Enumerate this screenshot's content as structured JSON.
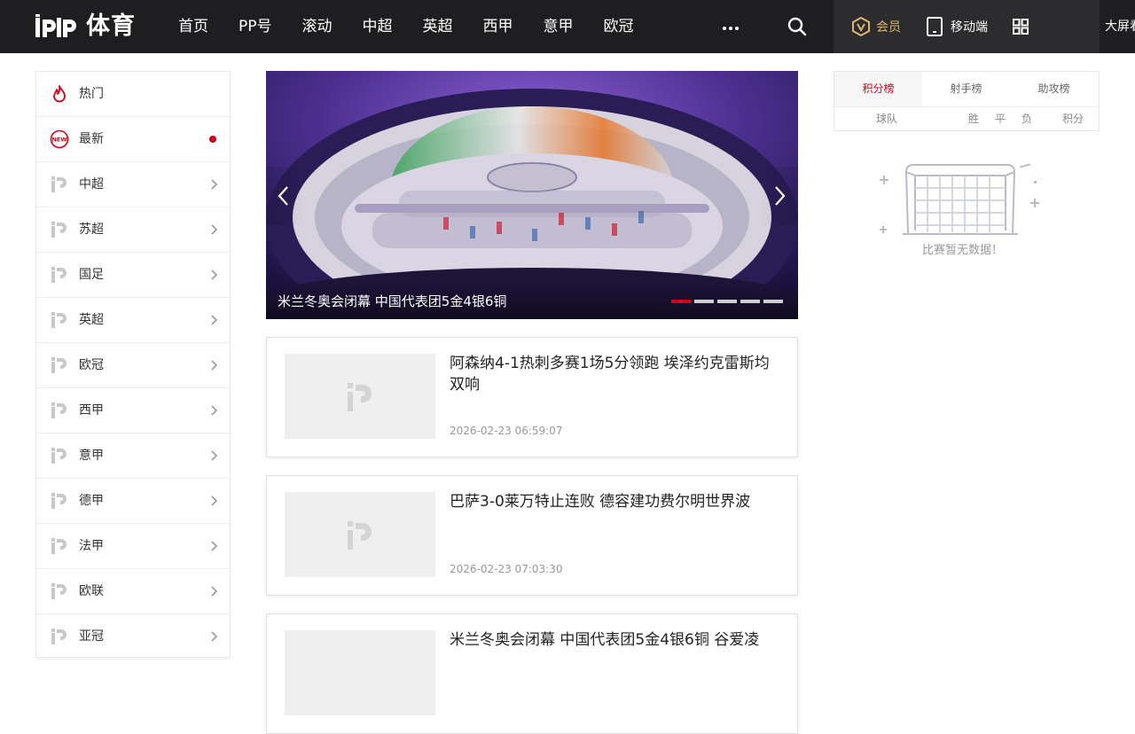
{
  "header": {
    "logo_text": "体育",
    "nav": [
      "首页",
      "PP号",
      "滚动",
      "中超",
      "英超",
      "西甲",
      "意甲",
      "欧冠"
    ],
    "more_icon": "more-dots-icon",
    "search_icon": "search-icon",
    "vip_label": "会员",
    "mobile_label": "移动端",
    "apps_icon": "grid-icon",
    "bigscreen_label": "大屏看"
  },
  "sidebar": {
    "items": [
      {
        "label": "热门",
        "icon": "fire-icon"
      },
      {
        "label": "最新",
        "icon": "new-icon",
        "dot": true
      },
      {
        "label": "中超",
        "icon": "pp-logo-icon"
      },
      {
        "label": "苏超",
        "icon": "pp-logo-icon"
      },
      {
        "label": "国足",
        "icon": "pp-logo-icon"
      },
      {
        "label": "英超",
        "icon": "pp-logo-icon"
      },
      {
        "label": "欧冠",
        "icon": "pp-logo-icon"
      },
      {
        "label": "西甲",
        "icon": "pp-logo-icon"
      },
      {
        "label": "意甲",
        "icon": "pp-logo-icon"
      },
      {
        "label": "德甲",
        "icon": "pp-logo-icon"
      },
      {
        "label": "法甲",
        "icon": "pp-logo-icon"
      },
      {
        "label": "欧联",
        "icon": "pp-logo-icon"
      },
      {
        "label": "亚冠",
        "icon": "pp-logo-icon"
      }
    ]
  },
  "carousel": {
    "caption": "米兰冬奥会闭幕 中国代表团5金4银6铜",
    "slide_count": 5,
    "active_index": 0,
    "accent_color": "#d0021b"
  },
  "news": [
    {
      "title": "阿森纳4-1热刺多赛1场5分领跑 埃泽约克雷斯均双响",
      "time": "2026-02-23 06:59:07"
    },
    {
      "title": "巴萨3-0莱万特止连败 德容建功费尔明世界波",
      "time": "2026-02-23 07:03:30"
    },
    {
      "title": "米兰冬奥会闭幕 中国代表团5金4银6铜 谷爱凌",
      "time": ""
    }
  ],
  "standings": {
    "tabs": [
      "积分榜",
      "射手榜",
      "助攻榜"
    ],
    "active_tab": 0,
    "columns": [
      "球队",
      "胜",
      "平",
      "负",
      "积分"
    ],
    "empty_text": "比赛暂无数据！"
  }
}
